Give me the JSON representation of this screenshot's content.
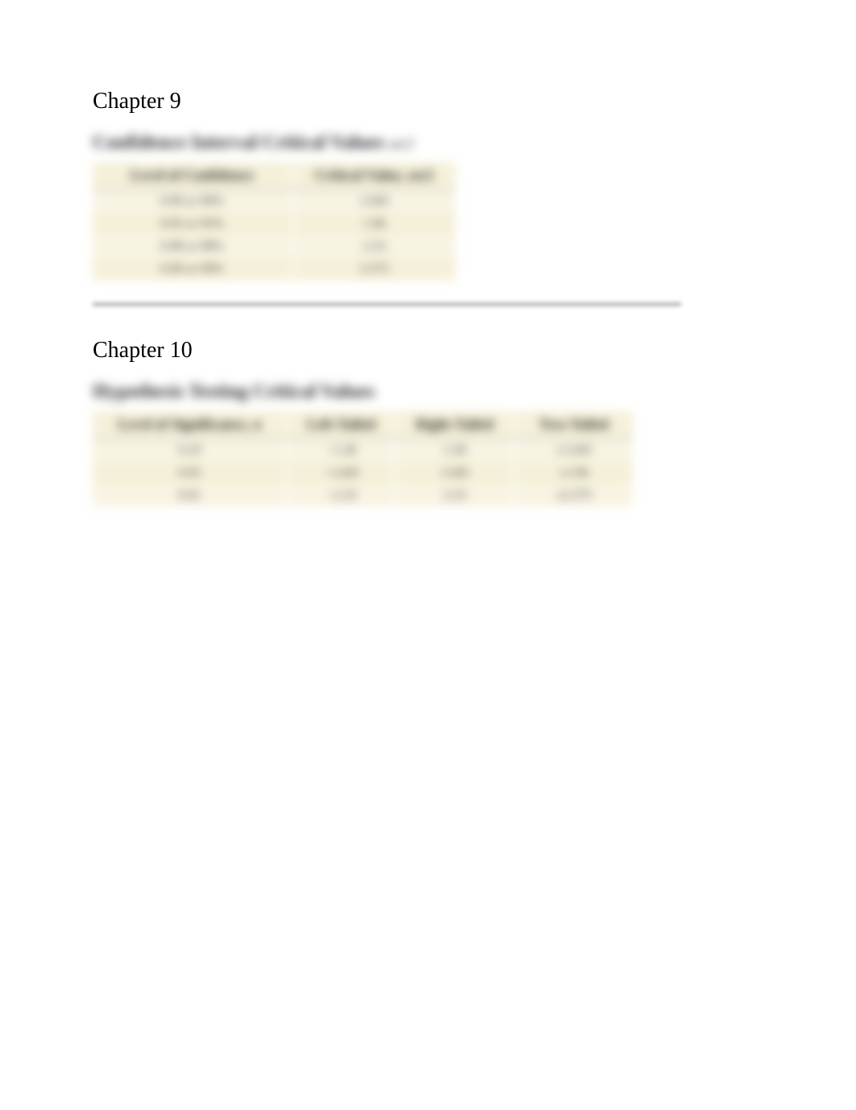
{
  "section1": {
    "heading": "Chapter 9",
    "title": "Confidence Interval Critical Values",
    "title_sub": "zα/2",
    "table": {
      "headers": [
        "Level of Confidence",
        "Critical Value, zα/2"
      ],
      "rows": [
        [
          "0.90 or 90%",
          "1.645"
        ],
        [
          "0.95 or 95%",
          "1.96"
        ],
        [
          "0.98 or 98%",
          "2.33"
        ],
        [
          "0.99 or 99%",
          "2.575"
        ]
      ]
    }
  },
  "section2": {
    "heading": "Chapter 10",
    "title": "Hypothesis Testing Critical Values",
    "table": {
      "headers": [
        "Level of Significance, α",
        "Left-Tailed",
        "Right-Tailed",
        "Two-Tailed"
      ],
      "rows": [
        [
          "0.10",
          "−1.28",
          "1.28",
          "±1.645"
        ],
        [
          "0.05",
          "−1.645",
          "1.645",
          "±1.96"
        ],
        [
          "0.01",
          "−2.33",
          "2.33",
          "±2.575"
        ]
      ]
    }
  }
}
